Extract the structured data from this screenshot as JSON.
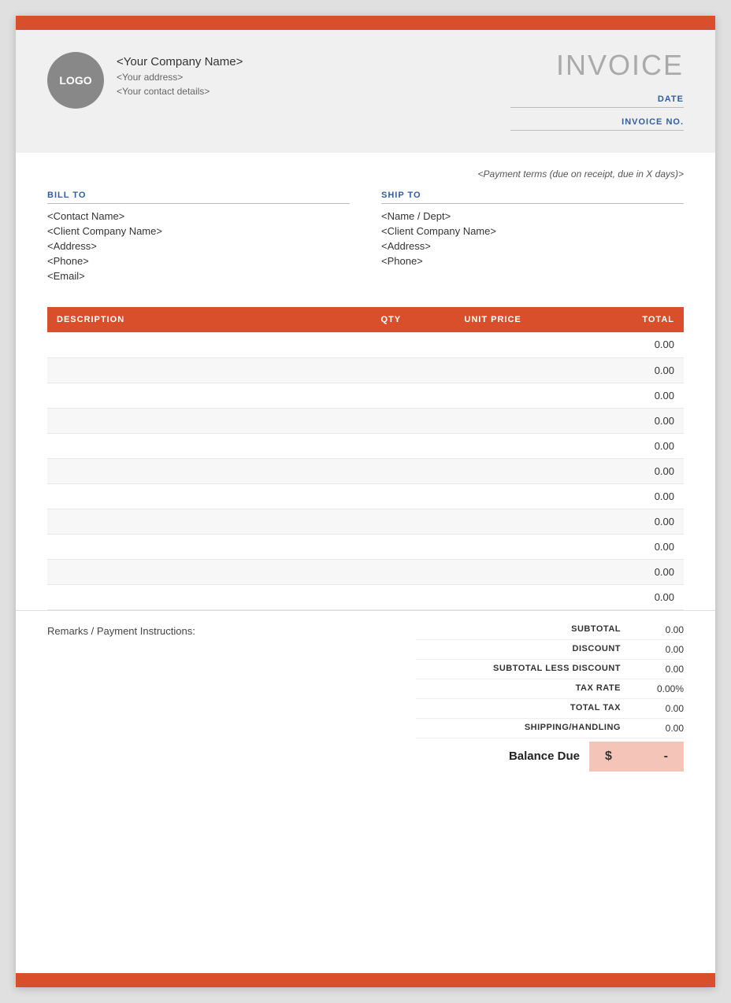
{
  "topBar": {
    "color": "#d94f2b"
  },
  "header": {
    "logo_text": "LOGO",
    "company_name": "<Your Company Name>",
    "company_address": "<Your address>",
    "company_contact": "<Your contact details>",
    "invoice_title": "INVOICE",
    "date_label": "DATE",
    "invoice_no_label": "INVOICE NO."
  },
  "content": {
    "payment_terms": "<Payment terms (due on receipt, due in X days)>",
    "bill_to": {
      "label": "BILL TO",
      "contact": "<Contact Name>",
      "company": "<Client Company Name>",
      "address": "<Address>",
      "phone": "<Phone>",
      "email": "<Email>"
    },
    "ship_to": {
      "label": "SHIP TO",
      "name_dept": "<Name / Dept>",
      "company": "<Client Company Name>",
      "address": "<Address>",
      "phone": "<Phone>"
    }
  },
  "table": {
    "headers": {
      "description": "DESCRIPTION",
      "qty": "QTY",
      "unit_price": "UNIT PRICE",
      "total": "TOTAL"
    },
    "rows": [
      {
        "description": "",
        "qty": "",
        "unit_price": "",
        "total": "0.00"
      },
      {
        "description": "",
        "qty": "",
        "unit_price": "",
        "total": "0.00"
      },
      {
        "description": "",
        "qty": "",
        "unit_price": "",
        "total": "0.00"
      },
      {
        "description": "",
        "qty": "",
        "unit_price": "",
        "total": "0.00"
      },
      {
        "description": "",
        "qty": "",
        "unit_price": "",
        "total": "0.00"
      },
      {
        "description": "",
        "qty": "",
        "unit_price": "",
        "total": "0.00"
      },
      {
        "description": "",
        "qty": "",
        "unit_price": "",
        "total": "0.00"
      },
      {
        "description": "",
        "qty": "",
        "unit_price": "",
        "total": "0.00"
      },
      {
        "description": "",
        "qty": "",
        "unit_price": "",
        "total": "0.00"
      },
      {
        "description": "",
        "qty": "",
        "unit_price": "",
        "total": "0.00"
      },
      {
        "description": "",
        "qty": "",
        "unit_price": "",
        "total": "0.00"
      }
    ]
  },
  "totals": {
    "remarks_label": "Remarks / Payment Instructions:",
    "subtotal_label": "SUBTOTAL",
    "subtotal_value": "0.00",
    "discount_label": "DISCOUNT",
    "discount_value": "0.00",
    "subtotal_less_discount_label": "SUBTOTAL LESS DISCOUNT",
    "subtotal_less_discount_value": "0.00",
    "tax_rate_label": "TAX RATE",
    "tax_rate_value": "0.00%",
    "total_tax_label": "TOTAL TAX",
    "total_tax_value": "0.00",
    "shipping_handling_label": "SHIPPING/HANDLING",
    "shipping_handling_value": "0.00",
    "balance_due_label": "Balance Due",
    "balance_due_currency": "$",
    "balance_due_value": "-"
  }
}
